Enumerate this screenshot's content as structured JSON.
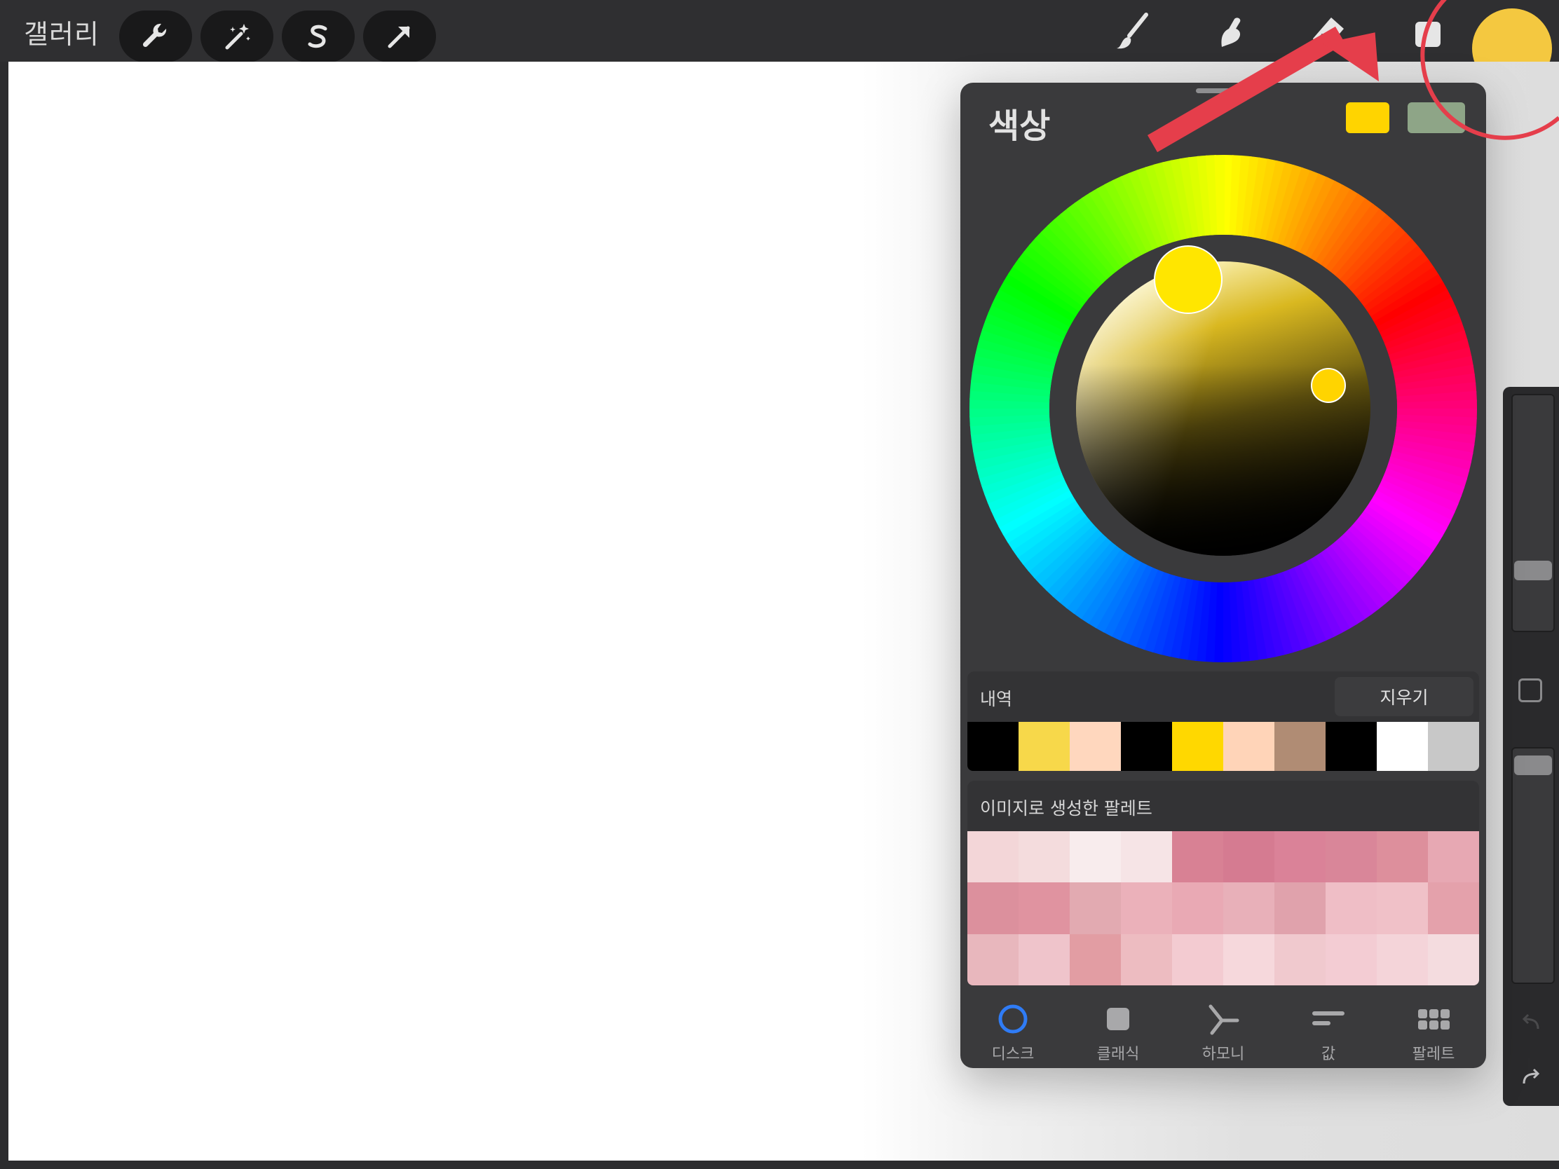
{
  "topbar": {
    "gallery_label": "갤러리",
    "left_tools": [
      "wrench-icon",
      "magic-wand-icon",
      "selection-s-icon",
      "transform-arrow-icon"
    ],
    "right_tools": [
      "brush-icon",
      "smudge-icon",
      "eraser-icon",
      "layers-icon"
    ],
    "current_color": "#f4c840"
  },
  "color_panel": {
    "title": "색상",
    "primary_swatch": "#ffd400",
    "secondary_swatch": "#8ea587",
    "selected_hue_marker": "#ffe600",
    "selected_color_marker": "#ffd400"
  },
  "history": {
    "label": "내역",
    "clear_label": "지우기",
    "colors": [
      "#000000",
      "#f7d84a",
      "#ffd7be",
      "#000000",
      "#ffd800",
      "#ffd4b8",
      "#b08c74",
      "#000000",
      "#ffffff",
      "#c8c8c8"
    ]
  },
  "palette": {
    "label": "이미지로 생성한 팔레트",
    "colors": [
      "#f3d6d8",
      "#f4dcdd",
      "#f8eced",
      "#f6e4e6",
      "#d88194",
      "#d57b91",
      "#da8298",
      "#d98699",
      "#dd8f9c",
      "#e7a8b3",
      "#dc909d",
      "#e093a0",
      "#e2aab1",
      "#ebb1ba",
      "#e9a9b4",
      "#e8b0b9",
      "#e0a2ac",
      "#efbec6",
      "#f0c1c8",
      "#e4a1ab",
      "#e8b7bd",
      "#efc4cb",
      "#e29da3",
      "#edbcc1",
      "#f3cbd1",
      "#f6d8dc",
      "#f0c9ce",
      "#f3ccd3",
      "#f4d4d9",
      "#f4dcdf"
    ]
  },
  "tabs": [
    {
      "label": "디스크",
      "icon": "disc-icon"
    },
    {
      "label": "클래식",
      "icon": "classic-square-icon"
    },
    {
      "label": "하모니",
      "icon": "harmony-icon"
    },
    {
      "label": "값",
      "icon": "value-sliders-icon"
    },
    {
      "label": "팔레트",
      "icon": "palette-grid-icon"
    }
  ],
  "accent": "#e53e4b"
}
